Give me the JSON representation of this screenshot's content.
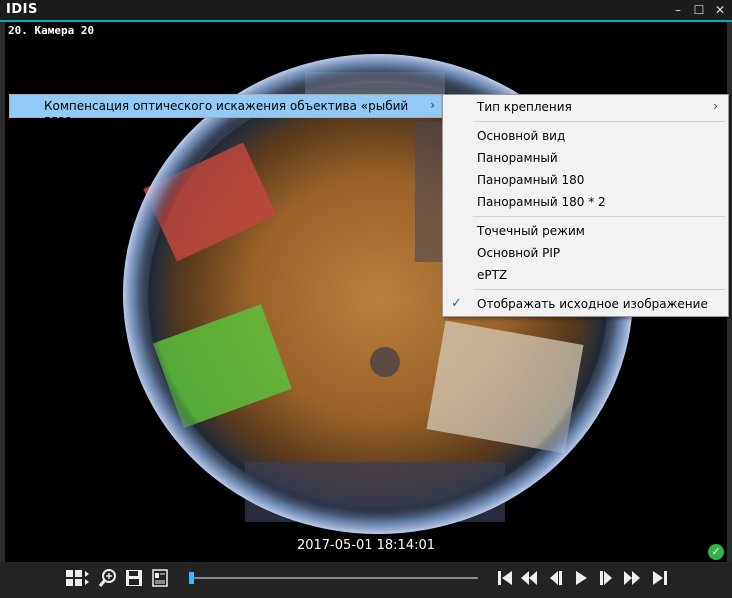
{
  "window": {
    "title": "IDIS",
    "minimize": "–",
    "maximize": "☐",
    "close": "✕"
  },
  "camera": {
    "label": "20. Камера 20",
    "timestamp": "2017-05-01 18:14:01",
    "status": "✓"
  },
  "context_menu": {
    "item": "Компенсация оптического искажения объектива «рыбий глаз»",
    "arrow": "›"
  },
  "submenu": {
    "mount_type": "Тип крепления",
    "mount_arrow": "›",
    "views": [
      "Основной вид",
      "Панорамный",
      "Панорамный 180",
      "Панорамный 180 * 2"
    ],
    "modes": [
      "Точечный режим",
      "Основной PIP",
      "ePTZ"
    ],
    "show_original": "Отображать исходное изображение",
    "show_original_checked": true,
    "check": "✓"
  },
  "toolbar": {
    "icons": [
      "layout-grid-icon",
      "zoom-icon",
      "save-icon",
      "report-icon",
      "skip-start-icon",
      "fast-rewind-icon",
      "step-back-icon",
      "play-icon",
      "step-forward-icon",
      "fast-forward-icon",
      "skip-end-icon"
    ],
    "progress": 0.0
  },
  "colors": {
    "accent": "#0aa7c9",
    "menu_highlight": "#91c9f7",
    "status_ok": "#2fb34a"
  }
}
